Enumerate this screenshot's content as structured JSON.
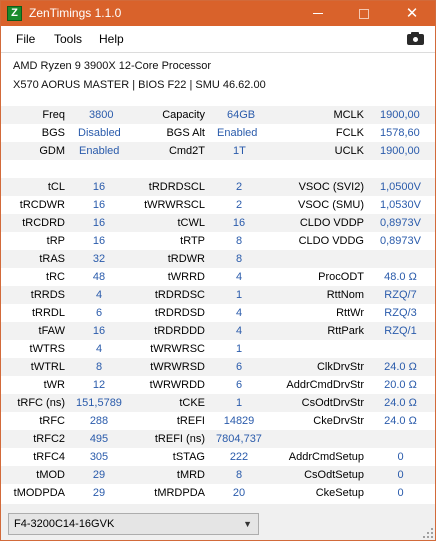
{
  "window": {
    "title": "ZenTimings 1.1.0",
    "app_icon_letter": "Z",
    "close_glyph": "✕"
  },
  "menu": {
    "file": "File",
    "tools": "Tools",
    "help": "Help",
    "screenshot_icon": "camera-icon"
  },
  "system": {
    "cpu": "AMD Ryzen 9 3900X 12-Core Processor",
    "board": "X570 AORUS MASTER | BIOS F22 | SMU 46.62.00"
  },
  "top_rows": [
    {
      "l1": "Freq",
      "v1": "3800",
      "l2": "Capacity",
      "v2": "64GB",
      "l3": "MCLK",
      "v3": "1900,00"
    },
    {
      "l1": "BGS",
      "v1": "Disabled",
      "l2": "BGS Alt",
      "v2": "Enabled",
      "l3": "FCLK",
      "v3": "1578,60"
    },
    {
      "l1": "GDM",
      "v1": "Enabled",
      "l2": "Cmd2T",
      "v2": "1T",
      "l3": "UCLK",
      "v3": "1900,00"
    }
  ],
  "timing_rows": [
    {
      "l1": "tCL",
      "v1": "16",
      "l2": "tRDRDSCL",
      "v2": "2",
      "l3": "VSOC (SVI2)",
      "v3": "1,0500V"
    },
    {
      "l1": "tRCDWR",
      "v1": "16",
      "l2": "tWRWRSCL",
      "v2": "2",
      "l3": "VSOC (SMU)",
      "v3": "1,0530V"
    },
    {
      "l1": "tRCDRD",
      "v1": "16",
      "l2": "tCWL",
      "v2": "16",
      "l3": "CLDO VDDP",
      "v3": "0,8973V"
    },
    {
      "l1": "tRP",
      "v1": "16",
      "l2": "tRTP",
      "v2": "8",
      "l3": "CLDO VDDG",
      "v3": "0,8973V"
    },
    {
      "l1": "tRAS",
      "v1": "32",
      "l2": "tRDWR",
      "v2": "8",
      "l3": "",
      "v3": ""
    },
    {
      "l1": "tRC",
      "v1": "48",
      "l2": "tWRRD",
      "v2": "4",
      "l3": "ProcODT",
      "v3": "48.0 Ω"
    },
    {
      "l1": "tRRDS",
      "v1": "4",
      "l2": "tRDRDSC",
      "v2": "1",
      "l3": "RttNom",
      "v3": "RZQ/7"
    },
    {
      "l1": "tRRDL",
      "v1": "6",
      "l2": "tRDRDSD",
      "v2": "4",
      "l3": "RttWr",
      "v3": "RZQ/3"
    },
    {
      "l1": "tFAW",
      "v1": "16",
      "l2": "tRDRDDD",
      "v2": "4",
      "l3": "RttPark",
      "v3": "RZQ/1"
    },
    {
      "l1": "tWTRS",
      "v1": "4",
      "l2": "tWRWRSC",
      "v2": "1",
      "l3": "",
      "v3": ""
    },
    {
      "l1": "tWTRL",
      "v1": "8",
      "l2": "tWRWRSD",
      "v2": "6",
      "l3": "ClkDrvStr",
      "v3": "24.0 Ω"
    },
    {
      "l1": "tWR",
      "v1": "12",
      "l2": "tWRWRDD",
      "v2": "6",
      "l3": "AddrCmdDrvStr",
      "v3": "20.0 Ω"
    },
    {
      "l1": "tRFC (ns)",
      "v1": "151,5789",
      "l2": "tCKE",
      "v2": "1",
      "l3": "CsOdtDrvStr",
      "v3": "24.0 Ω"
    },
    {
      "l1": "tRFC",
      "v1": "288",
      "l2": "tREFI",
      "v2": "14829",
      "l3": "CkeDrvStr",
      "v3": "24.0 Ω"
    },
    {
      "l1": "tRFC2",
      "v1": "495",
      "l2": "tREFI (ns)",
      "v2": "7804,737",
      "l3": "",
      "v3": ""
    },
    {
      "l1": "tRFC4",
      "v1": "305",
      "l2": "tSTAG",
      "v2": "222",
      "l3": "AddrCmdSetup",
      "v3": "0"
    },
    {
      "l1": "tMOD",
      "v1": "29",
      "l2": "tMRD",
      "v2": "8",
      "l3": "CsOdtSetup",
      "v3": "0"
    },
    {
      "l1": "tMODPDA",
      "v1": "29",
      "l2": "tMRDPDA",
      "v2": "20",
      "l3": "CkeSetup",
      "v3": "0"
    }
  ],
  "profile": {
    "selected": "F4-3200C14-16GVK",
    "arrow": "▼"
  }
}
